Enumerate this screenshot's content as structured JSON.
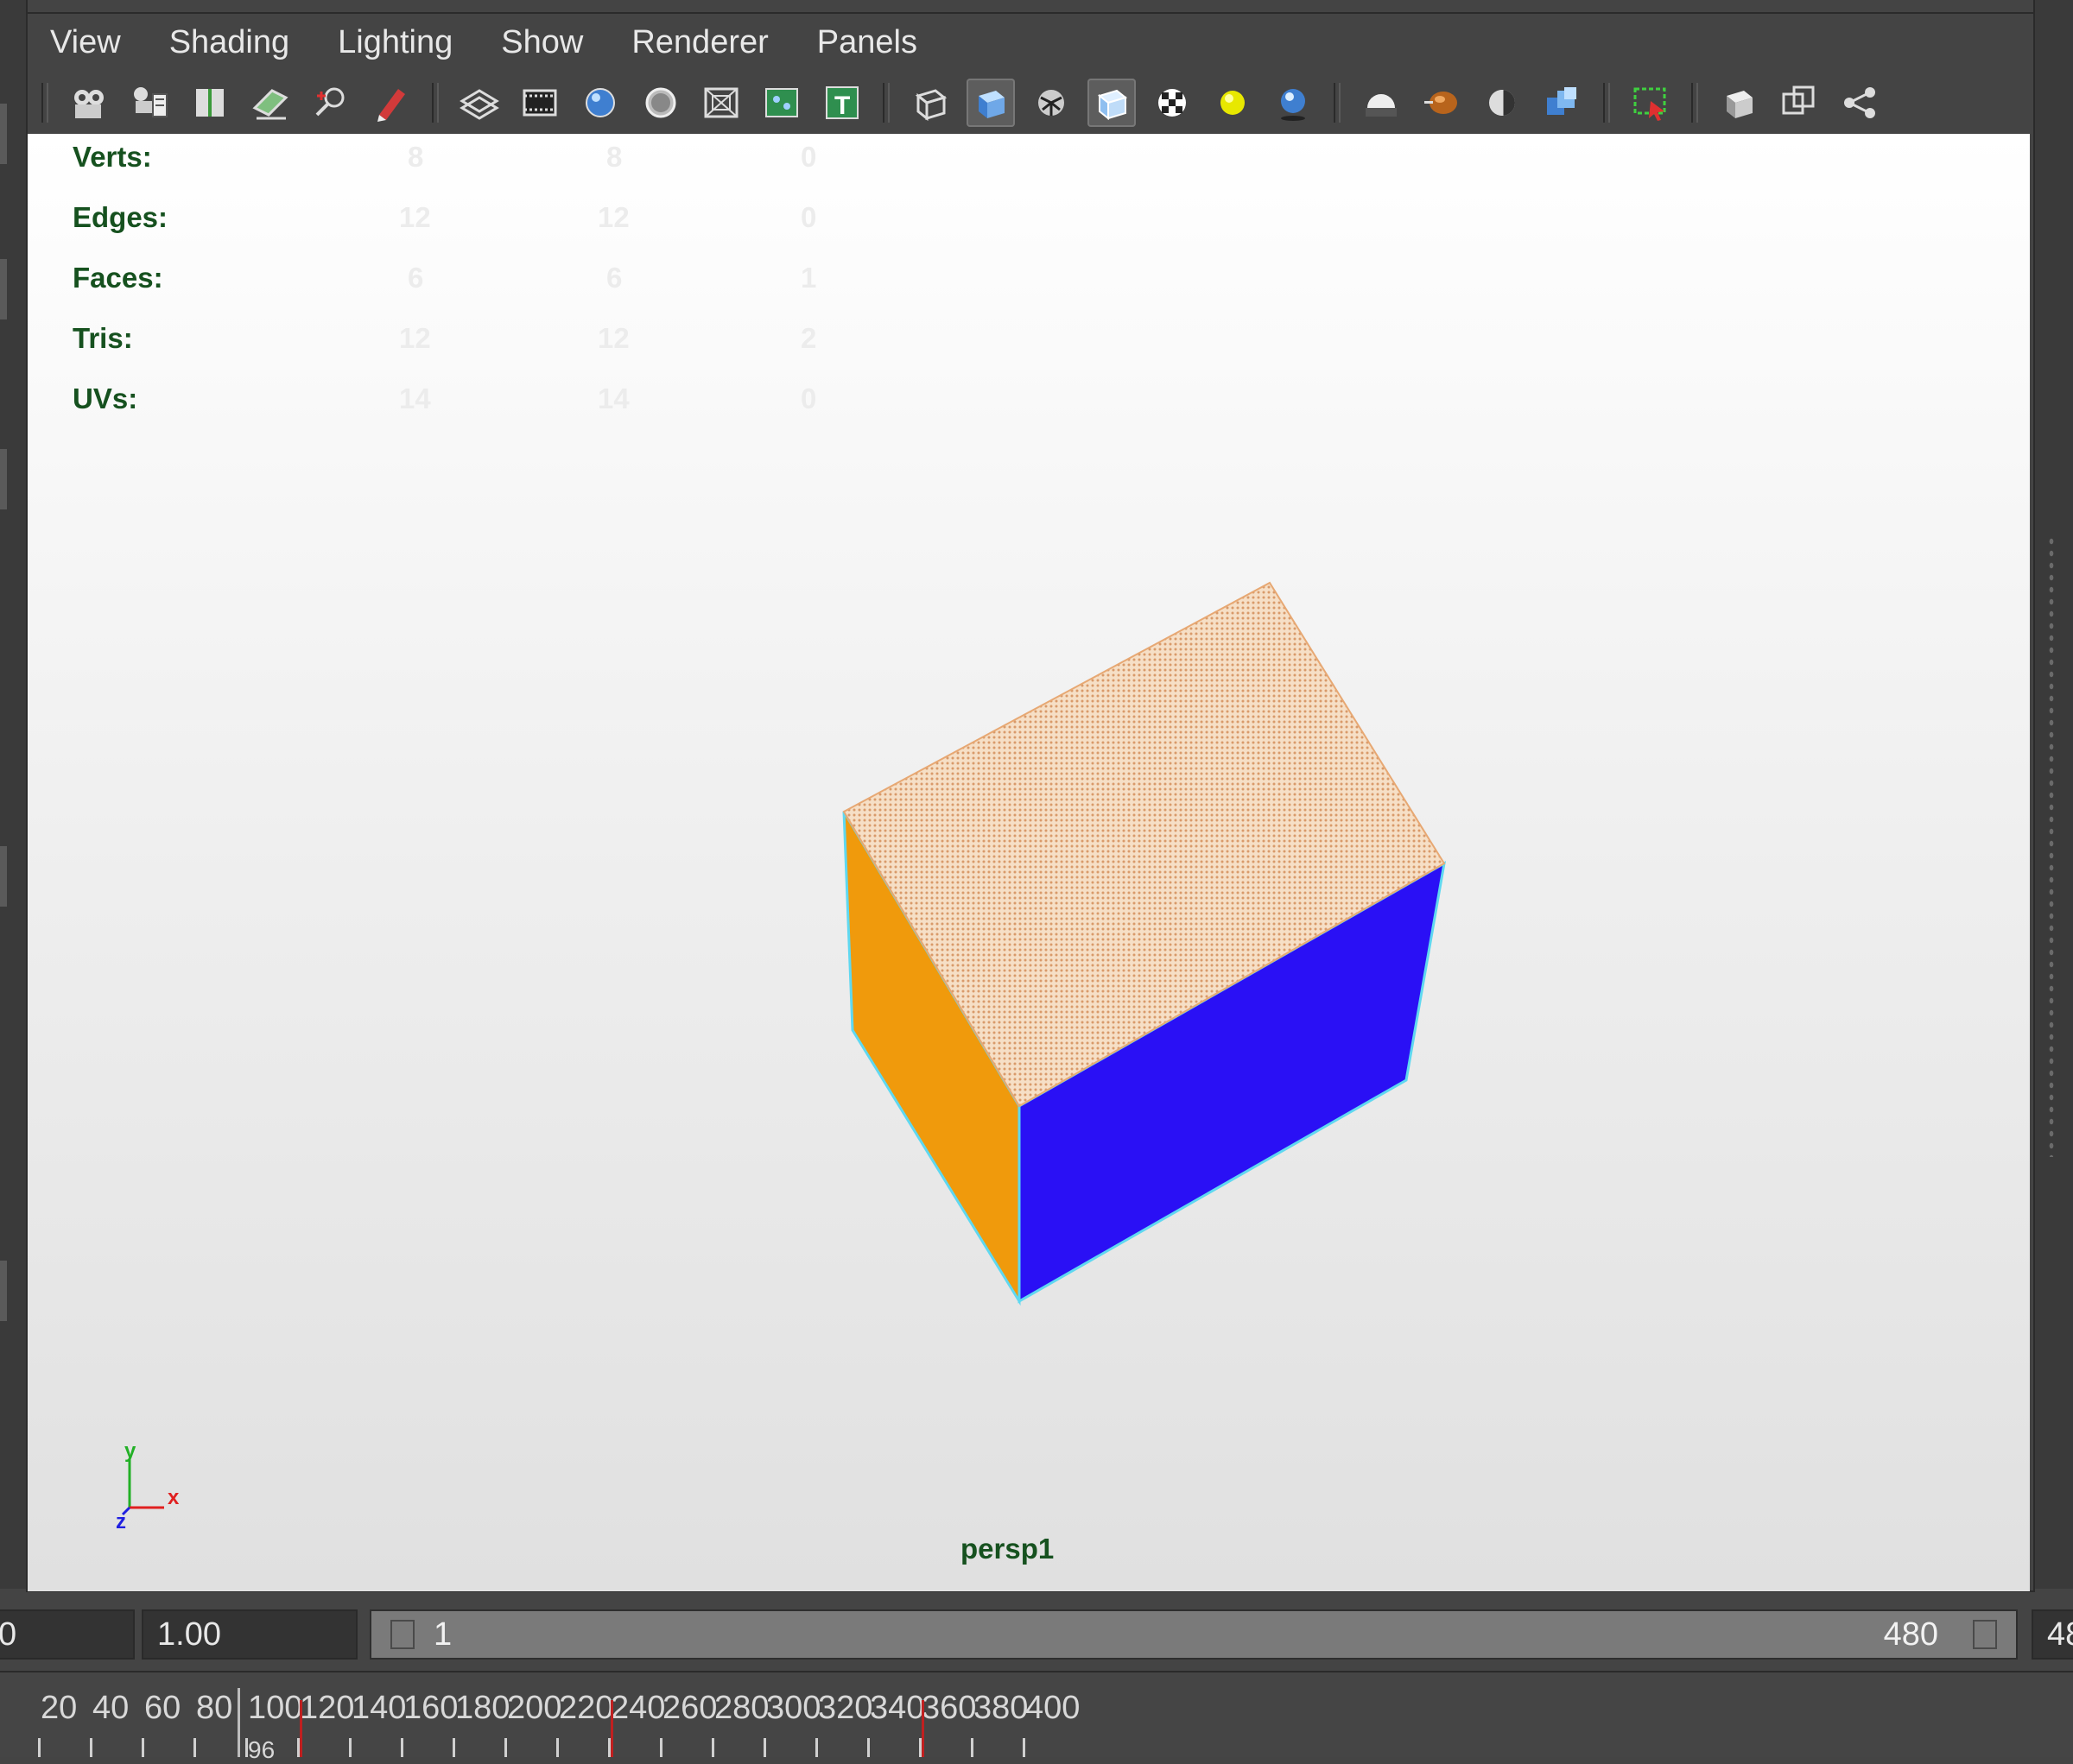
{
  "menu": [
    "View",
    "Shading",
    "Lighting",
    "Show",
    "Renderer",
    "Panels"
  ],
  "toolbar_groups": [
    [
      {
        "icon": "camera-icon",
        "active": false
      },
      {
        "icon": "camera-attributes-icon",
        "active": false
      },
      {
        "icon": "bookmark-icon",
        "active": false
      },
      {
        "icon": "image-plane-icon",
        "active": false
      },
      {
        "icon": "2d-pan-zoom-icon",
        "active": false
      },
      {
        "icon": "grease-pencil-icon",
        "active": false
      }
    ],
    [
      {
        "icon": "grid-icon",
        "active": false
      },
      {
        "icon": "film-gate-icon",
        "active": false
      },
      {
        "icon": "resolution-gate-icon",
        "active": false
      },
      {
        "icon": "gate-mask-icon",
        "active": false
      },
      {
        "icon": "field-chart-icon",
        "active": false
      },
      {
        "icon": "safe-action-icon",
        "active": false
      },
      {
        "icon": "safe-title-icon",
        "active": false
      }
    ],
    [
      {
        "icon": "wireframe-icon",
        "active": false
      },
      {
        "icon": "smooth-shade-icon",
        "active": true
      },
      {
        "icon": "wireframe-on-shaded-icon",
        "active": false
      },
      {
        "icon": "xray-icon",
        "active": true
      },
      {
        "icon": "textured-icon",
        "active": false
      },
      {
        "icon": "use-all-lights-icon",
        "active": false
      },
      {
        "icon": "shadows-icon",
        "active": false
      }
    ],
    [
      {
        "icon": "screen-space-ao-icon",
        "active": false
      },
      {
        "icon": "motion-blur-icon",
        "active": false
      },
      {
        "icon": "anti-aliasing-icon",
        "active": false
      },
      {
        "icon": "depth-of-field-icon",
        "active": false
      }
    ],
    [
      {
        "icon": "isolate-select-icon",
        "active": false
      }
    ],
    [
      {
        "icon": "xray-joints-icon",
        "active": false
      },
      {
        "icon": "xray-active-icon",
        "active": false
      },
      {
        "icon": "share-icon",
        "active": false
      }
    ]
  ],
  "hud": {
    "rows": [
      {
        "label": "Verts:",
        "values": [
          "8",
          "8",
          "0"
        ]
      },
      {
        "label": "Edges:",
        "values": [
          "12",
          "12",
          "0"
        ]
      },
      {
        "label": "Faces:",
        "values": [
          "6",
          "6",
          "1"
        ]
      },
      {
        "label": "Tris:",
        "values": [
          "12",
          "12",
          "2"
        ]
      },
      {
        "label": "UVs:",
        "values": [
          "14",
          "14",
          "0"
        ]
      }
    ]
  },
  "camera_label": "persp1",
  "axis": {
    "y": "y",
    "x": "x",
    "z": "z"
  },
  "colors": {
    "top_face": "#f6dfc6",
    "top_face_dots": "#d99a6a",
    "left_face": "#f09a0c",
    "right_face": "#2a10f5",
    "edge": "#5fd8f0",
    "hud_text": "#16511f"
  },
  "playback": {
    "field_left_value": "0",
    "field_start_value": "1.00",
    "range_start": "1",
    "range_end": "480",
    "field_right_value": "48"
  },
  "timeline": {
    "labels": [
      "20",
      "40",
      "60",
      "80",
      "100",
      "120",
      "140",
      "160",
      "180",
      "200",
      "220",
      "240",
      "260",
      "280",
      "300",
      "320",
      "340",
      "360",
      "380",
      "400"
    ],
    "current_frame": "96",
    "keyframes": [
      120,
      240,
      360
    ]
  }
}
